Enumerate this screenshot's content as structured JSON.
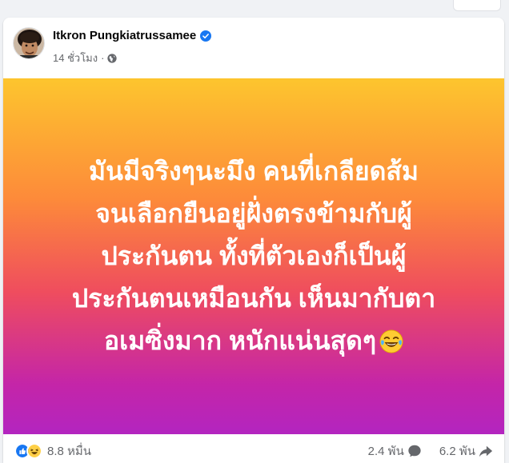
{
  "post": {
    "author": "Itkron Pungkiatrussamee",
    "timestamp": "14 ชั่วโมง",
    "separator": "·",
    "text": "มันมีจริงๆนะมึง คนที่เกลียดส้ม\nจนเลือกยืนอยู่ฝั่งตรงข้ามกับผู้\nประกันตน ทั้งที่ตัวเองก็เป็นผู้\nประกันตนเหมือนกัน เห็นมากับตา\nอเมซิ่งมาก หนักแน่นสุดๆ",
    "background_colors": [
      "#fdc52e",
      "#fd8a3a",
      "#ef4d5e",
      "#c425a8",
      "#b325c0"
    ]
  },
  "footer": {
    "reaction_count": "8.8 หมื่น",
    "comment_count": "2.4 พัน",
    "share_count": "6.2 พัน"
  },
  "icons": {
    "verified": "verified-badge-icon",
    "privacy": "globe-icon",
    "emoji": "laughing-tears-emoji",
    "like": "like-reaction-icon",
    "haha": "haha-reaction-icon",
    "comment": "comment-bubble-icon",
    "share": "share-arrow-icon"
  },
  "colors": {
    "accent_blue": "#1877f2",
    "secondary_text": "#65676b",
    "primary_text": "#050505"
  }
}
